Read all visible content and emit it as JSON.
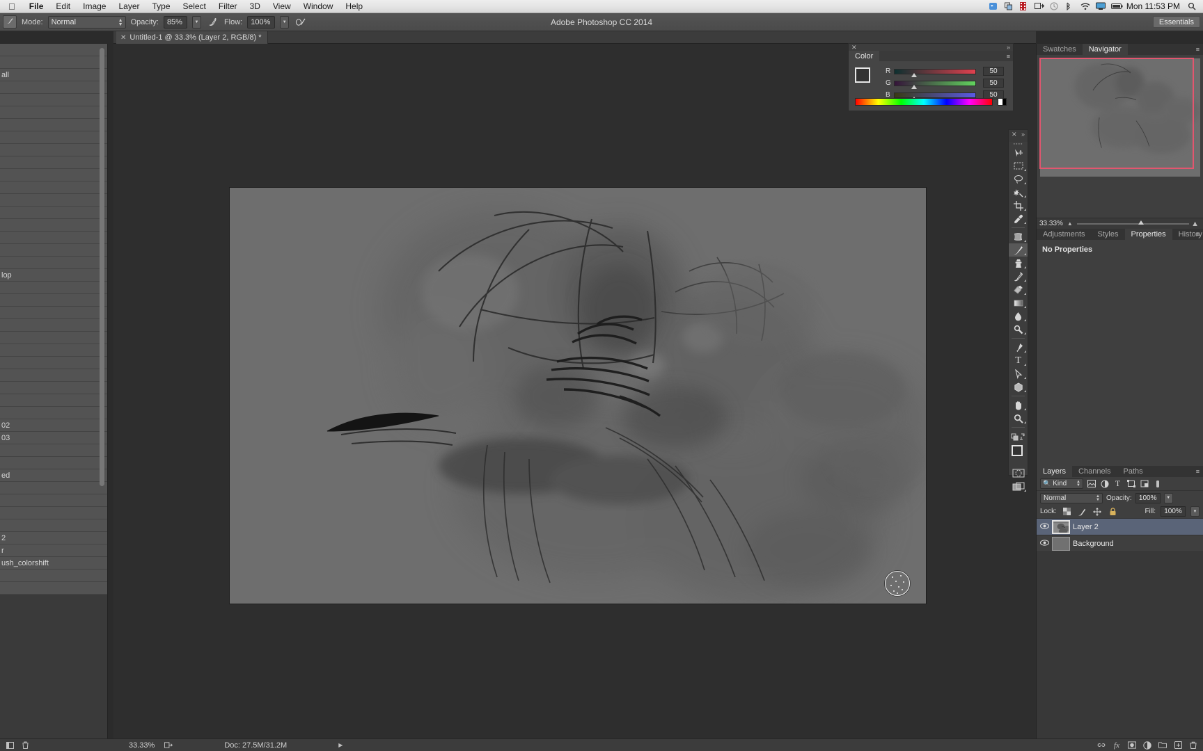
{
  "os_menu": {
    "apple_icon": "apple-icon",
    "items": [
      {
        "label": "File"
      },
      {
        "label": "Edit"
      },
      {
        "label": "Image"
      },
      {
        "label": "Layer"
      },
      {
        "label": "Type"
      },
      {
        "label": "Select"
      },
      {
        "label": "Filter"
      },
      {
        "label": "3D"
      },
      {
        "label": "View"
      },
      {
        "label": "Window"
      },
      {
        "label": "Help"
      }
    ],
    "status_icons": [
      "dropbox-icon",
      "duplicate-icon",
      "film-icon",
      "export-icon",
      "timemachine-icon",
      "bluetooth-icon",
      "wifi-icon",
      "display-icon",
      "battery-icon",
      "search-icon"
    ],
    "clock": "Mon 11:53 PM"
  },
  "app": {
    "title": "Adobe Photoshop CC 2014"
  },
  "options_bar": {
    "tool_preset_icon": "brush-preset-icon",
    "mode_label": "Mode:",
    "mode_value": "Normal",
    "opacity_label": "Opacity:",
    "opacity_value": "85%",
    "airbrush_icon": "airbrush-icon",
    "flow_label": "Flow:",
    "flow_value": "100%",
    "smoothing_icon": "smoothing-icon",
    "tablet_pressure_icon": "tablet-pressure-icon",
    "workspace": "Essentials"
  },
  "document": {
    "tab_title": "Untitled-1 @ 33.3% (Layer 2, RGB/8) *",
    "close_icon": "close-icon"
  },
  "color_panel": {
    "tab": "Color",
    "close_icon": "close-icon",
    "expand_icon": "expand-icon",
    "menu_icon": "panel-menu-icon",
    "foreground_color": "#333333",
    "background_color": "#f4f4f4",
    "channels": [
      {
        "label": "R",
        "value": "50"
      },
      {
        "label": "G",
        "value": "50"
      },
      {
        "label": "B",
        "value": "50"
      }
    ]
  },
  "tools_panel": {
    "close_icon": "close-icon",
    "collapse_icon": "collapse-icon",
    "items": [
      {
        "name": "move-tool",
        "glyph": "move",
        "active": false
      },
      {
        "name": "marquee-tool",
        "glyph": "marquee",
        "active": false
      },
      {
        "name": "lasso-tool",
        "glyph": "lasso",
        "active": false
      },
      {
        "name": "magic-wand-tool",
        "glyph": "wand",
        "active": false
      },
      {
        "name": "crop-tool",
        "glyph": "crop",
        "active": false
      },
      {
        "name": "eyedropper-tool",
        "glyph": "eyedropper",
        "active": false
      },
      {
        "name": "spot-healing-tool",
        "glyph": "healing",
        "active": false
      },
      {
        "name": "brush-tool",
        "glyph": "brush",
        "active": true
      },
      {
        "name": "clone-stamp-tool",
        "glyph": "stamp",
        "active": false
      },
      {
        "name": "history-brush-tool",
        "glyph": "historybrush",
        "active": false
      },
      {
        "name": "eraser-tool",
        "glyph": "eraser",
        "active": false
      },
      {
        "name": "gradient-tool",
        "glyph": "gradient",
        "active": false
      },
      {
        "name": "blur-tool",
        "glyph": "blur",
        "active": false
      },
      {
        "name": "dodge-tool",
        "glyph": "dodge",
        "active": false
      },
      {
        "name": "pen-tool",
        "glyph": "pen",
        "active": false
      },
      {
        "name": "type-tool",
        "glyph": "T",
        "active": false
      },
      {
        "name": "path-selection-tool",
        "glyph": "pathsel",
        "active": false
      },
      {
        "name": "shape-tool",
        "glyph": "shape",
        "active": false
      },
      {
        "name": "hand-tool",
        "glyph": "hand",
        "active": false
      },
      {
        "name": "zoom-tool",
        "glyph": "zoom",
        "active": false
      }
    ],
    "foreground_color": "#333333",
    "background_color": "#f2f2f2",
    "quickmask_icon": "quick-mask-icon",
    "screenmode_icon": "screen-mode-icon"
  },
  "dock": {
    "top_group": {
      "tabs": [
        {
          "label": "Swatches",
          "active": false
        },
        {
          "label": "Navigator",
          "active": true
        }
      ],
      "menu_icon": "panel-menu-icon",
      "zoom_value": "33.33%"
    },
    "mid_group": {
      "tabs": [
        {
          "label": "Adjustments",
          "active": false
        },
        {
          "label": "Styles",
          "active": false
        },
        {
          "label": "Properties",
          "active": true
        },
        {
          "label": "History",
          "active": false
        }
      ],
      "menu_icon": "panel-menu-icon",
      "empty_message": "No Properties"
    },
    "layers_group": {
      "tabs": [
        {
          "label": "Layers",
          "active": true
        },
        {
          "label": "Channels",
          "active": false
        },
        {
          "label": "Paths",
          "active": false
        }
      ],
      "menu_icon": "panel-menu-icon",
      "filter_label": "Kind",
      "filter_search_icon": "search-icon",
      "filter_icons": [
        "pixel-layer-icon",
        "adjustment-layer-icon",
        "type-layer-icon",
        "shape-layer-icon",
        "smart-object-icon",
        "filter-toggle-icon"
      ],
      "blend_mode": "Normal",
      "opacity_label": "Opacity:",
      "opacity_value": "100%",
      "lock_label": "Lock:",
      "lock_icons": [
        "lock-transparency-icon",
        "lock-image-icon",
        "lock-position-icon",
        "lock-all-icon"
      ],
      "fill_label": "Fill:",
      "fill_value": "100%",
      "layers": [
        {
          "name": "Layer 2",
          "visible": true,
          "selected": true,
          "eye_icon": "eye-icon"
        },
        {
          "name": "Background",
          "visible": true,
          "selected": false,
          "eye_icon": "eye-icon"
        }
      ]
    }
  },
  "status_bar": {
    "zoom": "33.33%",
    "fit_icon": "fit-screen-icon",
    "doc_info": "Doc: 27.5M/31.2M",
    "expand_arrow": "play-arrow-icon",
    "left_icons": [
      "panel-toggle-icon",
      "trash-icon"
    ],
    "right_icons": [
      "link-icon",
      "fx-icon",
      "mask-icon",
      "group-icon",
      "new-layer-icon",
      "delete-layer-icon"
    ]
  },
  "brush_presets": {
    "visible_labels": [
      "",
      "",
      "all",
      "",
      "",
      "",
      "",
      "",
      "",
      "",
      "",
      "",
      "",
      "",
      "",
      "",
      "",
      "",
      "lop",
      "",
      "",
      "",
      "",
      "",
      "",
      "",
      "",
      "",
      "",
      "",
      "02",
      "03",
      "",
      "",
      "ed",
      "",
      "",
      "",
      "",
      "2",
      "r",
      "ush_colorshift",
      "",
      ""
    ]
  }
}
